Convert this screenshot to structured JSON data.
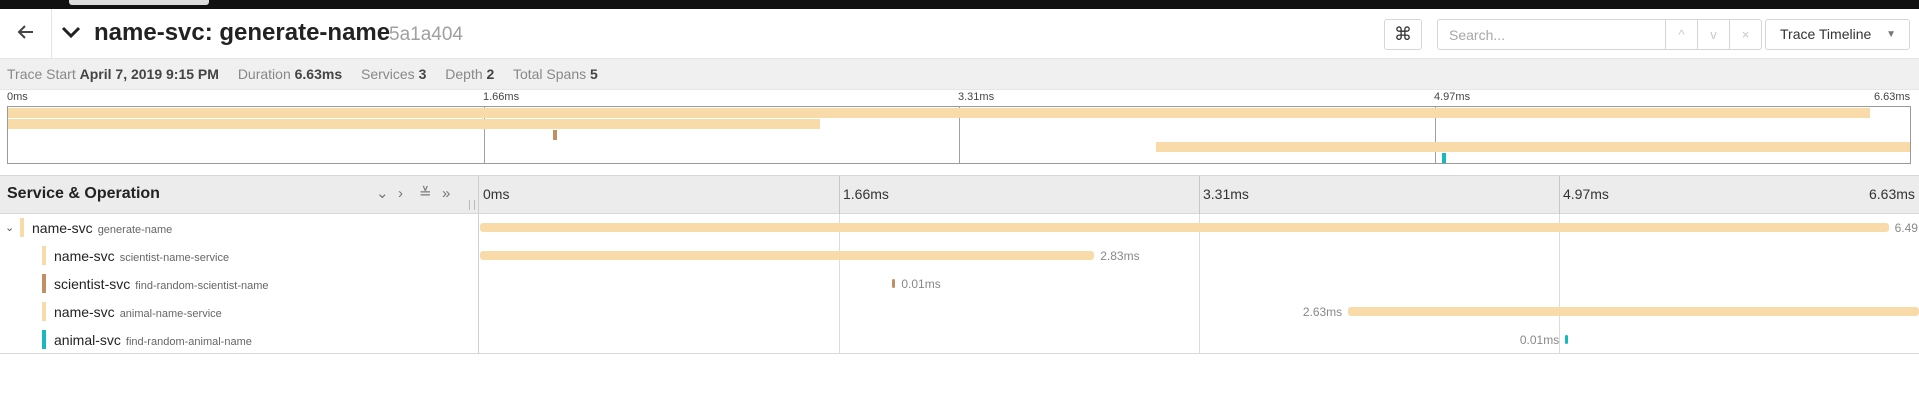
{
  "colors": {
    "name_svc": "#f8dba8",
    "scientist_svc": "#c18f62",
    "animal_svc": "#17b8be"
  },
  "header": {
    "back_icon": "arrow-left-icon",
    "collapse_icon": "chevron-down-icon",
    "title": "name-svc: generate-name",
    "trace_id": "5a1a404",
    "shortcut_icon": "⌘",
    "search_placeholder": "Search...",
    "prev_icon": "^",
    "next_icon": "v",
    "clear_icon": "×",
    "view_selector": "Trace Timeline"
  },
  "meta": {
    "trace_start_label": "Trace Start",
    "trace_start_value": "April 7, 2019 9:15 PM",
    "duration_label": "Duration",
    "duration_value": "6.63ms",
    "services_label": "Services",
    "services_value": "3",
    "depth_label": "Depth",
    "depth_value": "2",
    "total_spans_label": "Total Spans",
    "total_spans_value": "5"
  },
  "ticks": [
    "0ms",
    "1.66ms",
    "3.31ms",
    "4.97ms",
    "6.63ms"
  ],
  "timeline_header": {
    "title": "Service & Operation"
  },
  "spans": [
    {
      "service": "name-svc",
      "operation": "generate-name",
      "depth": 0,
      "color": "#f8dba8",
      "start_ms": 0,
      "duration_ms": 6.49,
      "label": "6.49",
      "label_side": "right"
    },
    {
      "service": "name-svc",
      "operation": "scientist-name-service",
      "depth": 1,
      "color": "#f8dba8",
      "start_ms": 0,
      "duration_ms": 2.83,
      "label": "2.83ms",
      "label_side": "right"
    },
    {
      "service": "scientist-svc",
      "operation": "find-random-scientist-name",
      "depth": 1,
      "color": "#c18f62",
      "start_ms": 1.9,
      "duration_ms": 0.01,
      "label": "0.01ms",
      "label_side": "right"
    },
    {
      "service": "name-svc",
      "operation": "animal-name-service",
      "depth": 1,
      "color": "#f8dba8",
      "start_ms": 4.0,
      "duration_ms": 2.63,
      "label": "2.63ms",
      "label_side": "left"
    },
    {
      "service": "animal-svc",
      "operation": "find-random-animal-name",
      "depth": 1,
      "color": "#17b8be",
      "start_ms": 5.0,
      "duration_ms": 0.01,
      "label": "0.01ms",
      "label_side": "left"
    }
  ],
  "minimap_spans": [
    {
      "start_ms": 0,
      "duration_ms": 6.49,
      "color": "#f8dba8"
    },
    {
      "start_ms": 0,
      "duration_ms": 2.83,
      "color": "#f8dba8"
    },
    {
      "start_ms": 1.9,
      "duration_ms": 0.01,
      "color": "#c18f62"
    },
    {
      "start_ms": 4.0,
      "duration_ms": 2.63,
      "color": "#f8dba8"
    },
    {
      "start_ms": 5.0,
      "duration_ms": 0.01,
      "color": "#17b8be"
    }
  ],
  "total_ms": 6.63
}
